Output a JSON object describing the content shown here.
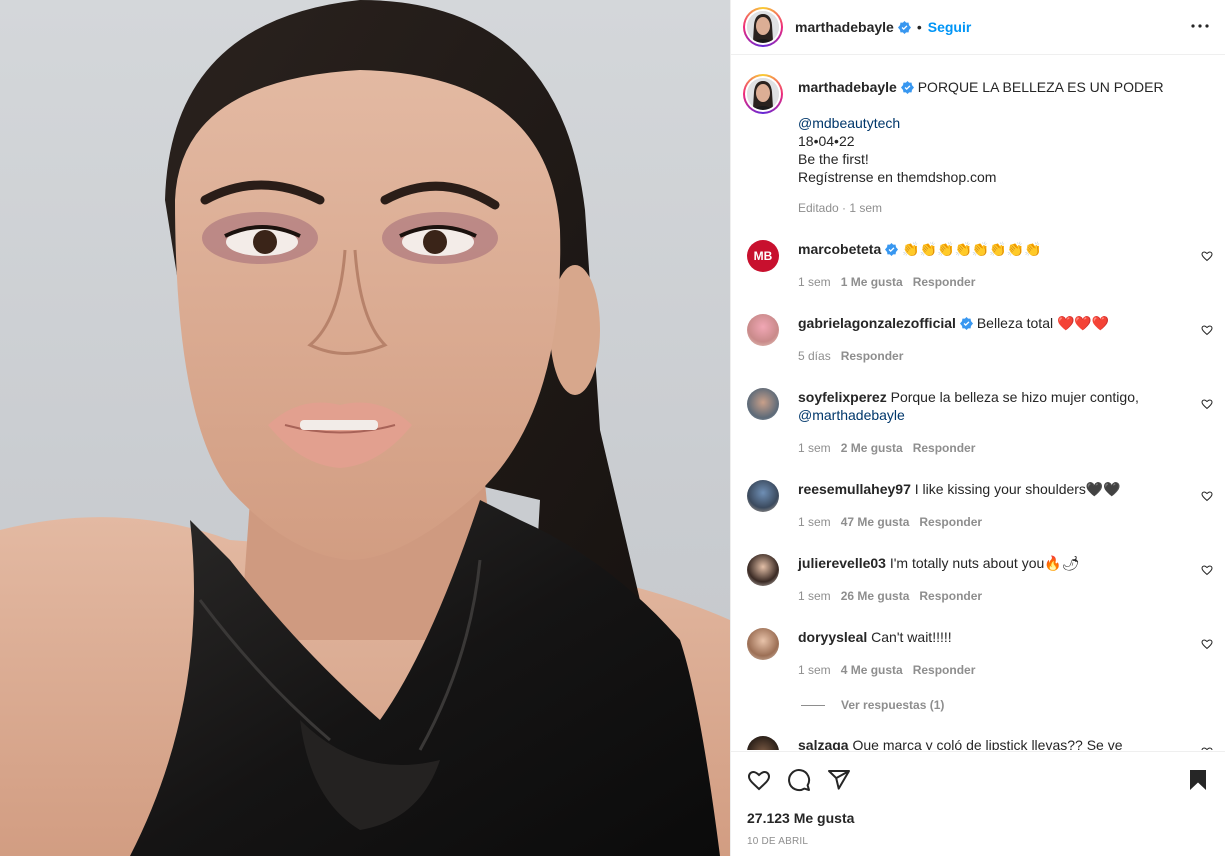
{
  "post": {
    "username": "marthadebayle",
    "follow_label": "Seguir",
    "separator": "•",
    "caption": {
      "username": "marthadebayle",
      "lines": [
        "PORQUE LA BELLEZA ES UN PODER",
        "",
        "@mdbeautytech",
        "18•04•22",
        "Be the first!",
        "Regístrense en themdshop.com"
      ],
      "mention": "@mdbeautytech",
      "meta": "Editado · 1 sem"
    },
    "likes": "27.123 Me gusta",
    "date": "10 DE ABRIL"
  },
  "comments": [
    {
      "username": "marcobeteta",
      "verified": true,
      "text": "👏👏👏👏👏👏👏👏",
      "time": "1 sem",
      "likes": "1 Me gusta",
      "reply": "Responder"
    },
    {
      "username": "gabrielagonzalezofficial",
      "verified": true,
      "text": "Belleza total ❤️❤️❤️",
      "time": "5 días",
      "likes": "",
      "reply": "Responder"
    },
    {
      "username": "soyfelixperez",
      "verified": false,
      "text": "Porque la belleza se hizo mujer contigo,",
      "mention": "@marthadebayle",
      "time": "1 sem",
      "likes": "2 Me gusta",
      "reply": "Responder"
    },
    {
      "username": "reesemullahey97",
      "verified": false,
      "text": "I like kissing your shoulders🖤🖤",
      "time": "1 sem",
      "likes": "47 Me gusta",
      "reply": "Responder"
    },
    {
      "username": "julierevelle03",
      "verified": false,
      "text": "I'm totally nuts about you🔥🌶",
      "time": "1 sem",
      "likes": "26 Me gusta",
      "reply": "Responder"
    },
    {
      "username": "doryysleal",
      "verified": false,
      "text": "Can't wait!!!!!",
      "time": "1 sem",
      "likes": "4 Me gusta",
      "reply": "Responder"
    },
    {
      "username": "salzaga",
      "verified": false,
      "text": "Que marca y coló de lipstick llevas?? Se ve hermoso!",
      "time": "",
      "likes": "",
      "reply": ""
    }
  ],
  "view_replies": "Ver respuestas (1)",
  "icons": {
    "more": "more-options-icon",
    "like": "heart-icon",
    "comment": "comment-icon",
    "share": "share-icon",
    "save": "bookmark-icon",
    "verified": "verified-badge-icon"
  },
  "colors": {
    "accent": "#0095f6",
    "verified": "#3897f0",
    "mention": "#00376b",
    "muted": "#8e8e8e"
  }
}
